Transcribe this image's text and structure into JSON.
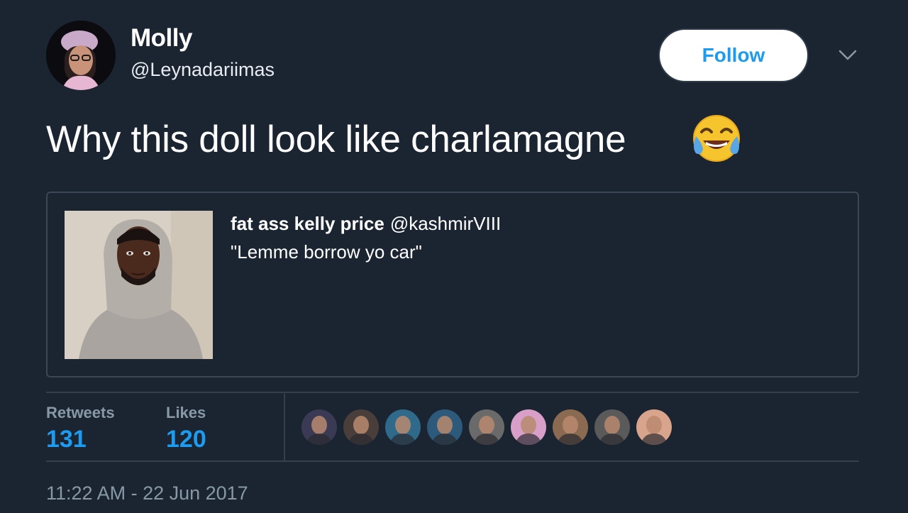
{
  "author": {
    "display_name": "Molly",
    "handle": "@Leynadariimas"
  },
  "follow_label": "Follow",
  "tweet": {
    "text": "Why this doll look like charlamagne",
    "emoji": "face-with-tears-of-joy"
  },
  "quote": {
    "author_name": "fat ass kelly price",
    "author_handle": "@kashmirVIII",
    "text": "\"Lemme borrow yo car\""
  },
  "stats": {
    "retweets_label": "Retweets",
    "retweets_value": "131",
    "likes_label": "Likes",
    "likes_value": "120"
  },
  "likers": [
    {
      "color": "#3b3a55"
    },
    {
      "color": "#4a3e3a"
    },
    {
      "color": "#2f6a8a"
    },
    {
      "color": "#2d5a7a"
    },
    {
      "color": "#6a6a6a"
    },
    {
      "color": "#d8a0c8"
    },
    {
      "color": "#8a6a50"
    },
    {
      "color": "#5a5a5a"
    },
    {
      "color": "#d9a48c"
    }
  ],
  "timestamp": "11:22 AM - 22 Jun 2017",
  "colors": {
    "background": "#1b2532",
    "accent": "#1d9bf0",
    "muted": "#8899a6"
  }
}
